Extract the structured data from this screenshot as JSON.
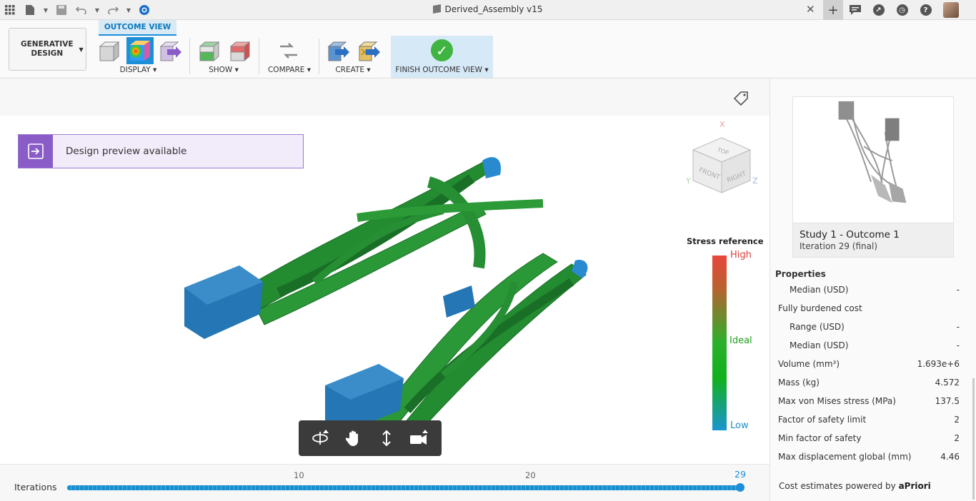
{
  "window": {
    "title": "Derived_Assembly v15"
  },
  "ribbon": {
    "generative_design_label_1": "GENERATIVE",
    "generative_design_label_2": "DESIGN",
    "tab_label": "OUTCOME VIEW",
    "groups": {
      "display": "DISPLAY ▾",
      "show": "SHOW ▾",
      "compare": "COMPARE ▾",
      "create": "CREATE ▾",
      "finish": "FINISH OUTCOME VIEW ▾"
    }
  },
  "viewport": {
    "banner_text": "Design preview available",
    "viewcube": {
      "top": "TOP",
      "front": "FRONT",
      "right": "RIGHT",
      "x": "X",
      "y": "Y",
      "z": "Z"
    },
    "stress": {
      "title": "Stress reference",
      "high": "High",
      "ideal": "Ideal",
      "low": "Low"
    }
  },
  "iterations": {
    "label": "Iterations",
    "ticks": [
      "10",
      "20"
    ],
    "current": "29",
    "progress": 1.0
  },
  "panel": {
    "outcome_title": "Study 1 - Outcome 1",
    "outcome_subtitle": "Iteration 29 (final)",
    "properties_heading": "Properties",
    "rows": [
      {
        "label": "Median (USD)",
        "value": "-",
        "indent": true
      },
      {
        "label": "Fully burdened cost",
        "value": "",
        "indent": false
      },
      {
        "label": "Range (USD)",
        "value": "-",
        "indent": true
      },
      {
        "label": "Median (USD)",
        "value": "-",
        "indent": true
      },
      {
        "label": "Volume (mm³)",
        "value": "1.693e+6",
        "indent": false
      },
      {
        "label": "Mass (kg)",
        "value": "4.572",
        "indent": false
      },
      {
        "label": "Max von Mises stress (MPa)",
        "value": "137.5",
        "indent": false
      },
      {
        "label": "Factor of safety limit",
        "value": "2",
        "indent": false
      },
      {
        "label": "Min factor of safety",
        "value": "2",
        "indent": false
      },
      {
        "label": "Max displacement global (mm)",
        "value": "4.46",
        "indent": false
      }
    ],
    "footer_prefix": "Cost estimates powered by",
    "footer_brand": "aPriori"
  },
  "colors": {
    "accent": "#1d8fd8",
    "banner": "#8a5cc8",
    "finish_check": "#3fb441",
    "model_green": "#1f8a2e",
    "model_blue": "#2477b4"
  }
}
